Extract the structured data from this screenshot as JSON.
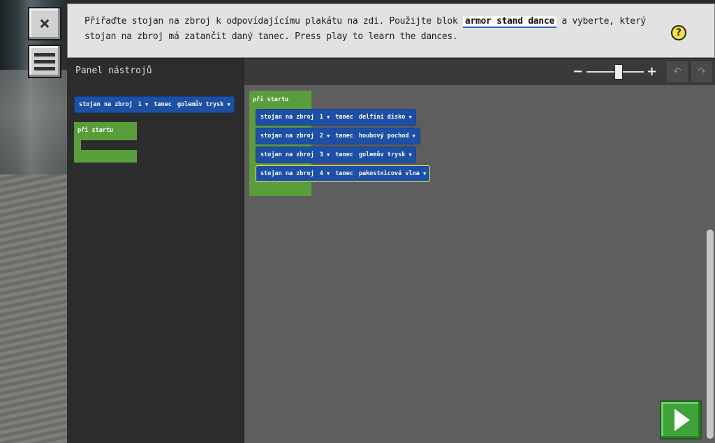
{
  "instruction": {
    "text_part1": "Přiřaďte stojan na zbroj k odpovídajícímu plakátu na zdi. Použijte blok ",
    "code": "armor stand dance",
    "text_part2": " a vyberte, který stojan na zbroj má zatančit daný tanec. Press play to learn the dances.",
    "hint_glyph": "?"
  },
  "buttons": {
    "close_glyph": "⨯",
    "play_icon": "play-icon"
  },
  "toolbox": {
    "title": "Panel nástrojů",
    "armor_block": {
      "label": "stojan na zbroj",
      "number": "1",
      "dance_label": "tanec",
      "dance": "golemův trysk"
    },
    "start_block": {
      "label": "při startu"
    }
  },
  "workspace": {
    "zoom_minus": "−",
    "zoom_plus": "+",
    "undo": "↶",
    "redo": "↷",
    "start_block": {
      "label": "při startu"
    },
    "blocks": [
      {
        "label": "stojan na zbroj",
        "number": "1",
        "dance_label": "tanec",
        "dance": "delfíní disko"
      },
      {
        "label": "stojan na zbroj",
        "number": "2",
        "dance_label": "tanec",
        "dance": "houbový pochod"
      },
      {
        "label": "stojan na zbroj",
        "number": "3",
        "dance_label": "tanec",
        "dance": "golemův trysk"
      },
      {
        "label": "stojan na zbroj",
        "number": "4",
        "dance_label": "tanec",
        "dance": "pakostnicová vlna"
      }
    ]
  },
  "colors": {
    "event_block": "#5a9e3b",
    "action_block": "#1d4fa6",
    "play": "#3ea33a",
    "selection": "#f5e34a"
  }
}
